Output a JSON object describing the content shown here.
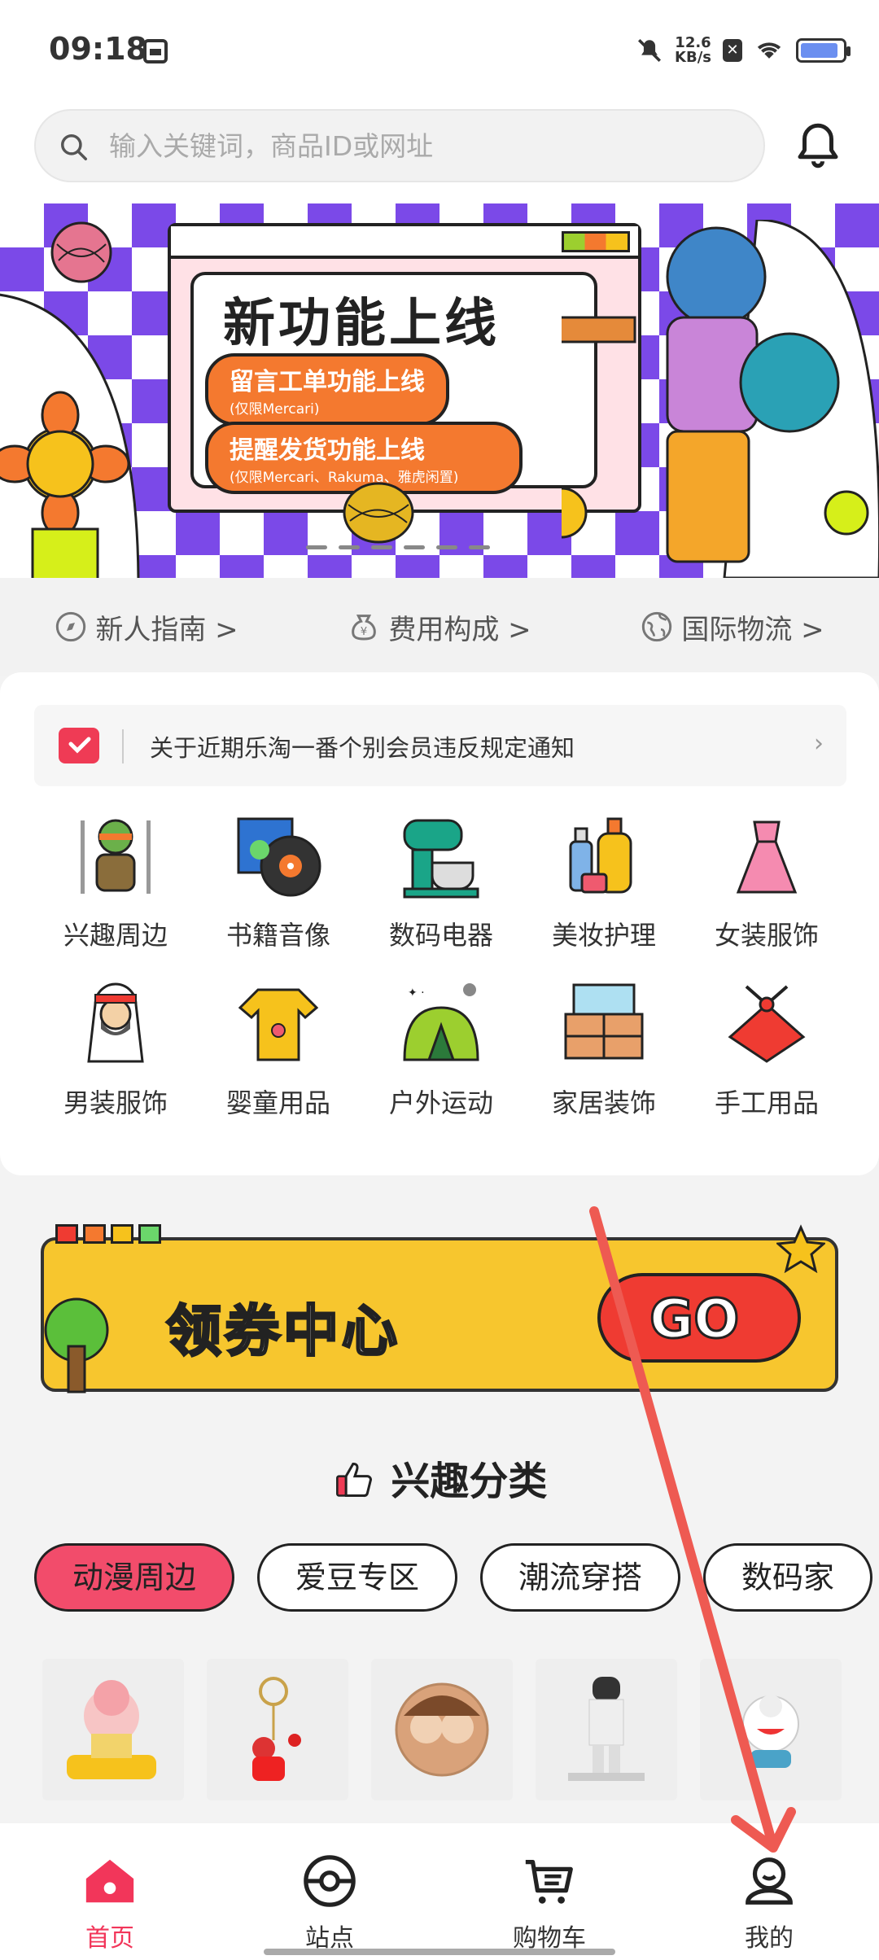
{
  "status_bar": {
    "time": "09:18",
    "net_speed_value": "12.6",
    "net_speed_unit": "KB/s",
    "battery_level": 0.9
  },
  "search": {
    "placeholder": "输入关键词，商品ID或网址"
  },
  "banner": {
    "title": "新功能上线",
    "line1": "留言工单功能上线",
    "line1_note": "(仅限Mercari)",
    "line2": "提醒发货功能上线",
    "line2_note": "(仅限Mercari、Rakuma、雅虎闲置)",
    "pages": 6
  },
  "quick_links": [
    {
      "label": "新人指南 >",
      "icon": "compass-icon"
    },
    {
      "label": "费用构成 >",
      "icon": "money-bag-icon"
    },
    {
      "label": "国际物流 >",
      "icon": "globe-icon"
    }
  ],
  "notice": {
    "text": "关于近期乐淘一番个别会员违反规定通知"
  },
  "categories": [
    {
      "label": "兴趣周边",
      "icon": "figure-icon"
    },
    {
      "label": "书籍音像",
      "icon": "record-icon"
    },
    {
      "label": "数码电器",
      "icon": "mixer-icon"
    },
    {
      "label": "美妆护理",
      "icon": "cosmetics-icon"
    },
    {
      "label": "女装服饰",
      "icon": "dress-icon"
    },
    {
      "label": "男装服饰",
      "icon": "man-icon"
    },
    {
      "label": "婴童用品",
      "icon": "baby-clothes-icon"
    },
    {
      "label": "户外运动",
      "icon": "tent-icon"
    },
    {
      "label": "家居装饰",
      "icon": "dresser-icon"
    },
    {
      "label": "手工用品",
      "icon": "gift-wrap-icon"
    }
  ],
  "coupon": {
    "title": "领券中心",
    "go": "GO"
  },
  "interest": {
    "title": "兴趣分类"
  },
  "chips": [
    {
      "label": "动漫周边",
      "active": true
    },
    {
      "label": "爱豆专区",
      "active": false
    },
    {
      "label": "潮流穿搭",
      "active": false
    },
    {
      "label": "数码家",
      "active": false
    }
  ],
  "tabs": [
    {
      "label": "首页",
      "icon": "home-icon",
      "active": true
    },
    {
      "label": "站点",
      "icon": "pokeball-icon",
      "active": false
    },
    {
      "label": "购物车",
      "icon": "cart-icon",
      "active": false
    },
    {
      "label": "我的",
      "icon": "profile-icon",
      "active": false
    }
  ],
  "colors": {
    "accent": "#f2365a",
    "banner_purple": "#7b49e8",
    "coupon_yellow": "#f7c62e"
  }
}
